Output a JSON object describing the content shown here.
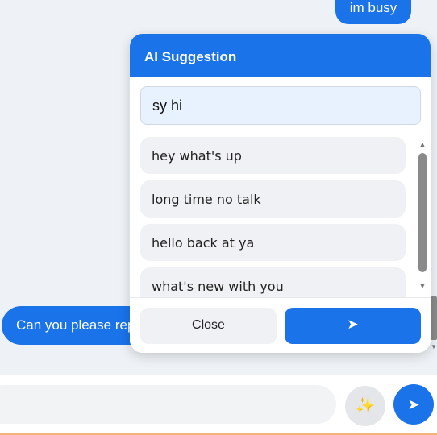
{
  "chat": {
    "outgoing_message": "im busy",
    "incoming_message": "Can you please rep"
  },
  "popup": {
    "title": "AI Suggestion",
    "query_value": "sy hi",
    "suggestions": [
      "hey what's up",
      "long time no talk",
      "hello back at ya",
      "what's new with you"
    ],
    "close_label": "Close",
    "send_icon": "➤"
  },
  "composer": {
    "ai_icon": "✨",
    "send_icon": "➤"
  },
  "colors": {
    "accent": "#1a73e8",
    "background": "#eef2f6"
  }
}
